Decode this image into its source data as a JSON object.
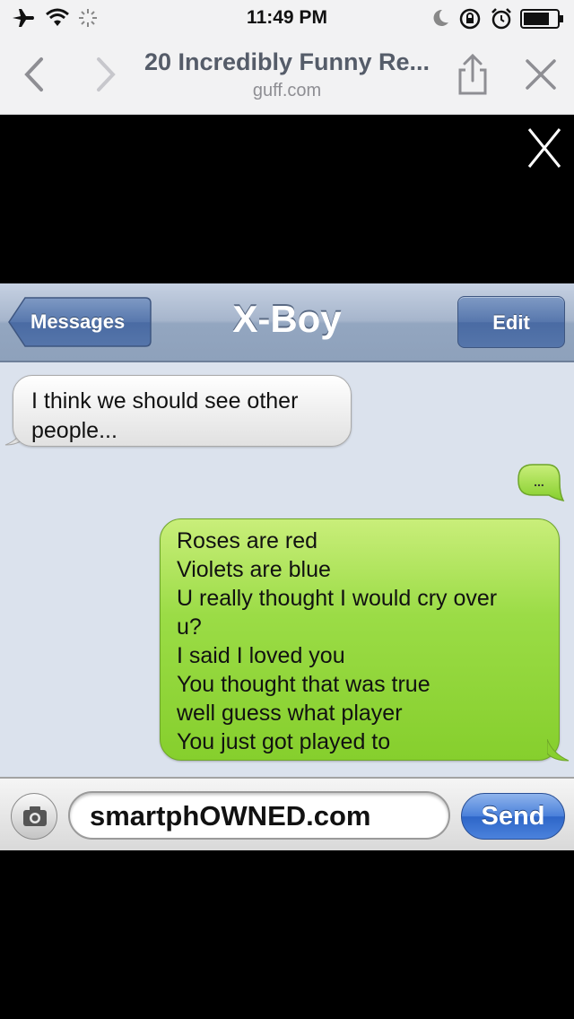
{
  "status_bar": {
    "time": "11:49 PM"
  },
  "browser": {
    "page_title": "20 Incredibly Funny Re...",
    "domain": "guff.com"
  },
  "overlay": {
    "close_icon": "close-x-icon"
  },
  "conversation": {
    "back_label": "Messages",
    "contact_name": "X-Boy",
    "edit_label": "Edit",
    "incoming_message": "I think we should see other\npeople...",
    "typing_indicator": "...",
    "outgoing_lines": [
      "Roses are red",
      "Violets are blue",
      "U really thought I would cry over",
      "u?",
      "I said I loved you",
      "You thought that was true",
      "well guess what player",
      "You just got played to"
    ],
    "input_text": "smartphOWNED.com",
    "send_label": "Send"
  },
  "colors": {
    "outgoing_bubble": "#8fd53a",
    "incoming_bubble": "#eeeeee",
    "nav_bar": "#a6b5cc",
    "send_button": "#3f76d4"
  }
}
